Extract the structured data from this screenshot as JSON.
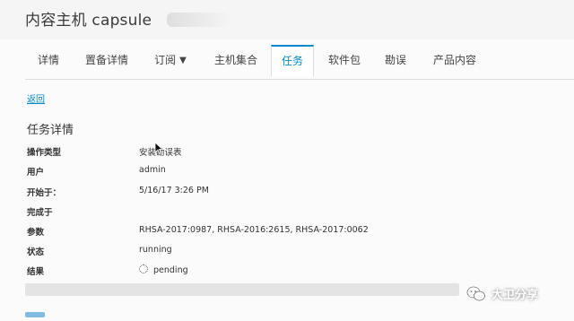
{
  "header": {
    "title": "内容主机 capsule"
  },
  "tabs": [
    {
      "label": "详情"
    },
    {
      "label": "置备详情"
    },
    {
      "label": "订阅"
    },
    {
      "label": "主机集合"
    },
    {
      "label": "任务"
    },
    {
      "label": "软件包"
    },
    {
      "label": "勘误"
    },
    {
      "label": "产品内容"
    }
  ],
  "active_tab": "任务",
  "back_link": "返回",
  "task": {
    "section_title": "任务详情",
    "fields": [
      {
        "label": "操作类型",
        "value": "安装勘误表"
      },
      {
        "label": "用户",
        "value": "admin"
      },
      {
        "label": "开始于：",
        "value": "5/16/17 3:26 PM"
      },
      {
        "label": "完成于",
        "value": ""
      },
      {
        "label": "参数",
        "value": "RHSA-2017:0987, RHSA-2016:2615, RHSA-2017:0062"
      },
      {
        "label": "状态",
        "value": "running"
      },
      {
        "label": "结果",
        "value": "pending"
      }
    ],
    "progress": 0
  },
  "watermark": {
    "text": "大卫分享"
  },
  "colors": {
    "accent": "#0088ce",
    "progress_track": "#e4e4e4"
  }
}
